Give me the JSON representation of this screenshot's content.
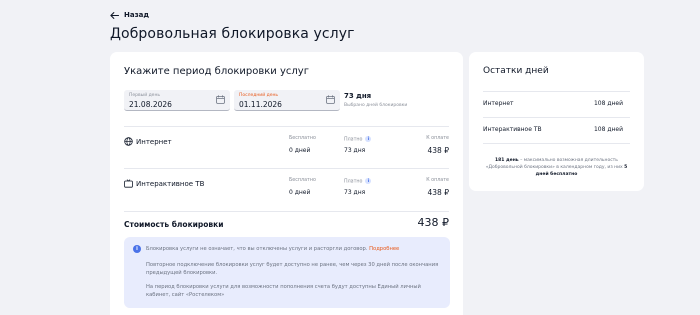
{
  "nav": {
    "back_label": "Назад"
  },
  "page": {
    "title": "Добровольная блокировка услуг"
  },
  "period": {
    "heading": "Укажите период блокировки услуг",
    "first_day": {
      "label": "Первый день",
      "value": "21.08.2026"
    },
    "last_day": {
      "label": "Последний день",
      "value": "01.11.2026"
    },
    "total_days": "73 дня",
    "total_note": "Выбрано дней блокировки"
  },
  "columns": {
    "free": "Бесплатно",
    "paid": "Платно",
    "pay": "К оплате"
  },
  "services": [
    {
      "name": "Интернет",
      "free": "0 дней",
      "paid": "73 дня",
      "pay": "438 ₽"
    },
    {
      "name": "Интерактивное ТВ",
      "free": "0 дней",
      "paid": "73 дня",
      "pay": "438 ₽"
    }
  ],
  "cost": {
    "label": "Стоимость блокировки",
    "value": "438 ₽"
  },
  "notice": {
    "p1_text": "Блокировка услуги не означает, что вы отключены услуги и расторгли договор.",
    "p1_link": "Подробнее",
    "p2": "Повторное подключение блокировки услуг будет доступно не ранее, чем через 30 дней после окончания предыдущей блокировки.",
    "p3": "На период блокировки услуги для возможности пополнения счета будут доступны Единый личный кабинет, сайт «Ростелеком»"
  },
  "remaining": {
    "heading": "Остатки дней",
    "rows": [
      {
        "name": "Интернет",
        "value": "108 дней"
      },
      {
        "name": "Интерактивное ТВ",
        "value": "108 дней"
      }
    ],
    "note_bold1": "181 день",
    "note_mid": " – максимально возможная длительность «Добровольной блокировки» в календарном году, из них ",
    "note_bold2": "5 дней бесплатно"
  }
}
